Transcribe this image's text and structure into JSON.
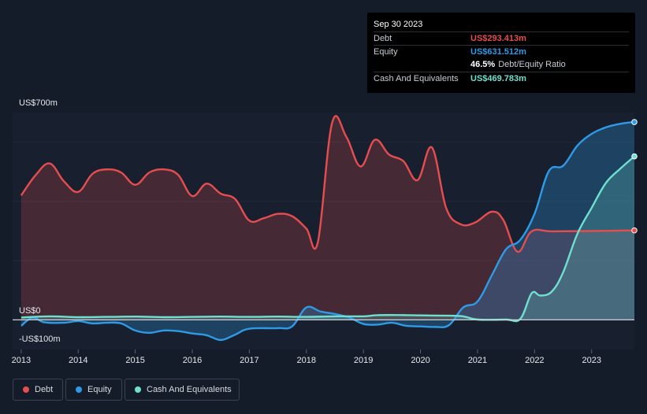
{
  "tooltip": {
    "date": "Sep 30 2023",
    "debt_label": "Debt",
    "debt_value": "US$293.413m",
    "equity_label": "Equity",
    "equity_value": "US$631.512m",
    "ratio_value": "46.5%",
    "ratio_label": "Debt/Equity Ratio",
    "cash_label": "Cash And Equivalents",
    "cash_value": "US$469.783m"
  },
  "legend": {
    "debt": "Debt",
    "equity": "Equity",
    "cash": "Cash And Equivalents"
  },
  "colors": {
    "background": "#151c29",
    "debt": "#e64d4f",
    "equity": "#2f9ae6",
    "cash": "#6ee0cf",
    "zero_line": "#cdd1d8"
  },
  "chart_data": {
    "type": "area",
    "ylim": [
      -100,
      700
    ],
    "xlim": [
      2012.85,
      2023.75
    ],
    "y_tick_labels": [
      {
        "value": 700,
        "label": "US$700m"
      },
      {
        "value": 0,
        "label": "US$0"
      },
      {
        "value": -100,
        "label": "-US$100m"
      }
    ],
    "x_ticks": [
      2013,
      2014,
      2015,
      2016,
      2017,
      2018,
      2019,
      2020,
      2021,
      2022,
      2023
    ],
    "x_tick_labels": [
      "2013",
      "2014",
      "2015",
      "2016",
      "2017",
      "2018",
      "2019",
      "2020",
      "2021",
      "2022",
      "2023"
    ],
    "grid_values": [
      0,
      200,
      400,
      600
    ],
    "series": [
      {
        "name": "Debt",
        "color": "#e64d4f",
        "points": [
          [
            2013.0,
            420
          ],
          [
            2013.25,
            488
          ],
          [
            2013.5,
            528
          ],
          [
            2013.75,
            468
          ],
          [
            2014.0,
            432
          ],
          [
            2014.25,
            493
          ],
          [
            2014.5,
            508
          ],
          [
            2014.75,
            498
          ],
          [
            2015.0,
            456
          ],
          [
            2015.25,
            498
          ],
          [
            2015.5,
            508
          ],
          [
            2015.75,
            490
          ],
          [
            2016.0,
            418
          ],
          [
            2016.25,
            460
          ],
          [
            2016.5,
            426
          ],
          [
            2016.75,
            408
          ],
          [
            2017.0,
            335
          ],
          [
            2017.25,
            343
          ],
          [
            2017.5,
            358
          ],
          [
            2017.75,
            350
          ],
          [
            2018.0,
            308
          ],
          [
            2018.2,
            262
          ],
          [
            2018.45,
            665
          ],
          [
            2018.7,
            618
          ],
          [
            2018.95,
            518
          ],
          [
            2019.2,
            608
          ],
          [
            2019.45,
            558
          ],
          [
            2019.7,
            536
          ],
          [
            2019.95,
            472
          ],
          [
            2020.2,
            582
          ],
          [
            2020.45,
            378
          ],
          [
            2020.7,
            323
          ],
          [
            2020.95,
            328
          ],
          [
            2021.25,
            365
          ],
          [
            2021.45,
            338
          ],
          [
            2021.7,
            230
          ],
          [
            2021.95,
            299
          ],
          [
            2022.3,
            299
          ],
          [
            2023.0,
            300
          ],
          [
            2023.75,
            302
          ]
        ]
      },
      {
        "name": "Equity",
        "color": "#2f9ae6",
        "points": [
          [
            2013.0,
            -20
          ],
          [
            2013.2,
            8
          ],
          [
            2013.4,
            -8
          ],
          [
            2013.75,
            -10
          ],
          [
            2014.0,
            -4
          ],
          [
            2014.25,
            -12
          ],
          [
            2014.5,
            -10
          ],
          [
            2014.75,
            -12
          ],
          [
            2015.0,
            -36
          ],
          [
            2015.25,
            -44
          ],
          [
            2015.5,
            -36
          ],
          [
            2015.75,
            -38
          ],
          [
            2016.0,
            -46
          ],
          [
            2016.25,
            -52
          ],
          [
            2016.5,
            -68
          ],
          [
            2016.75,
            -50
          ],
          [
            2017.0,
            -30
          ],
          [
            2017.5,
            -28
          ],
          [
            2017.75,
            -22
          ],
          [
            2018.0,
            42
          ],
          [
            2018.25,
            28
          ],
          [
            2018.5,
            20
          ],
          [
            2018.75,
            8
          ],
          [
            2019.0,
            -14
          ],
          [
            2019.25,
            -16
          ],
          [
            2019.5,
            -10
          ],
          [
            2019.75,
            -20
          ],
          [
            2020.0,
            -22
          ],
          [
            2020.25,
            -24
          ],
          [
            2020.5,
            -18
          ],
          [
            2020.75,
            42
          ],
          [
            2021.0,
            62
          ],
          [
            2021.25,
            150
          ],
          [
            2021.5,
            238
          ],
          [
            2021.75,
            270
          ],
          [
            2022.0,
            358
          ],
          [
            2022.25,
            502
          ],
          [
            2022.5,
            520
          ],
          [
            2022.75,
            588
          ],
          [
            2023.0,
            628
          ],
          [
            2023.25,
            650
          ],
          [
            2023.5,
            662
          ],
          [
            2023.75,
            668
          ]
        ]
      },
      {
        "name": "Cash And Equivalents",
        "color": "#6ee0cf",
        "points": [
          [
            2013.0,
            8
          ],
          [
            2013.5,
            12
          ],
          [
            2014.0,
            9
          ],
          [
            2014.5,
            10
          ],
          [
            2015.0,
            11
          ],
          [
            2015.5,
            9
          ],
          [
            2016.0,
            10
          ],
          [
            2016.5,
            11
          ],
          [
            2017.0,
            10
          ],
          [
            2017.5,
            11
          ],
          [
            2018.0,
            10
          ],
          [
            2018.5,
            12
          ],
          [
            2019.0,
            12
          ],
          [
            2019.25,
            16
          ],
          [
            2019.75,
            16
          ],
          [
            2020.0,
            15
          ],
          [
            2020.5,
            14
          ],
          [
            2020.75,
            12
          ],
          [
            2021.0,
            1
          ],
          [
            2021.5,
            1
          ],
          [
            2021.75,
            3
          ],
          [
            2021.95,
            90
          ],
          [
            2022.1,
            82
          ],
          [
            2022.3,
            95
          ],
          [
            2022.5,
            160
          ],
          [
            2022.75,
            290
          ],
          [
            2023.0,
            378
          ],
          [
            2023.25,
            462
          ],
          [
            2023.5,
            510
          ],
          [
            2023.75,
            552
          ]
        ]
      }
    ]
  }
}
